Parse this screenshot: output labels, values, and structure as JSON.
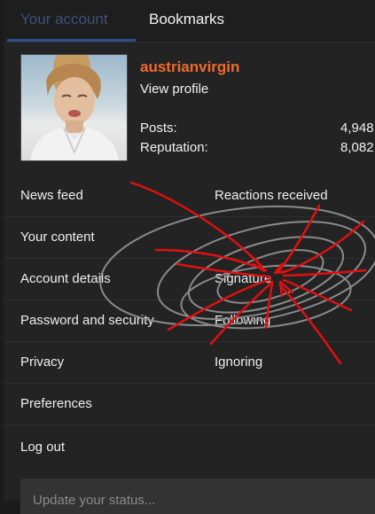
{
  "tabs": [
    {
      "label": "Your account"
    },
    {
      "label": "Bookmarks"
    }
  ],
  "profile": {
    "username": "austrianvirgin",
    "view_profile": "View profile",
    "stats": [
      {
        "label": "Posts:",
        "value": "4,948"
      },
      {
        "label": "Reputation:",
        "value": "8,082"
      }
    ]
  },
  "menu": {
    "left": [
      "News feed",
      "Your content",
      "Account details",
      "Password and security",
      "Privacy",
      "Preferences",
      "Log out"
    ],
    "right": [
      "Reactions received",
      "",
      "Signature",
      "Following",
      "Ignoring"
    ]
  },
  "status": {
    "placeholder": "Update your status..."
  },
  "colors": {
    "accent": "#f26a2b",
    "active_tab": "#2f4f95",
    "panel_bg": "#232323",
    "scribble_red": "#e01010",
    "scribble_gray": "#8a8a8a"
  }
}
